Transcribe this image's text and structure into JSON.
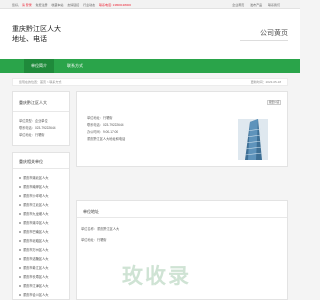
{
  "topbar": {
    "welcome": "您好，",
    "highlight": "请 登录",
    "items": [
      "免费注册",
      "收藏本站",
      "友情链接",
      "行业动态",
      "联系电话: 13800138000"
    ],
    "right_items": [
      "企业黄页",
      "发布产品",
      "联系我们"
    ]
  },
  "site": {
    "title_line1": "重庆黔江区人大",
    "title_line2": "地址、电话",
    "ad_text": "公司黄页"
  },
  "nav": {
    "items": [
      "单位简介",
      "联系方式"
    ]
  },
  "breadcrumb": {
    "text": "您现在的位置：首页 > 联系方式",
    "time": "更新时间：2023-05-18"
  },
  "left_panel": {
    "title": "重庆黔江区人大",
    "report_label": "我要纠错",
    "rows": [
      {
        "k": "单位类型：",
        "v": "企业单位"
      },
      {
        "k": "联系电话：",
        "v": "023-79222644"
      },
      {
        "k": "单位地址：",
        "v": "行署街"
      }
    ]
  },
  "related": {
    "title": "重庆相关单位",
    "items": [
      "重庆市渝北区人大",
      "重庆市南岸区人大",
      "重庆市沙坪坝人大",
      "重庆市江北区人大",
      "重庆市九龙坡人大",
      "重庆市渝中区人大",
      "重庆市巴南区人大",
      "重庆市北碚区人大",
      "重庆市万州区人大",
      "重庆市涪陵区人大",
      "重庆市綦江区人大",
      "重庆市长寿区人大",
      "重庆市江津区人大",
      "重庆市合川区人大"
    ]
  },
  "contact": {
    "rows": [
      {
        "k": "单位地址：",
        "v": "行署街"
      },
      {
        "k": "联系电话：",
        "v": "023-79222644"
      },
      {
        "k": "办公时间：",
        "v": "9:00-17:00"
      },
      {
        "k": "",
        "v": "重庆黔江区人大地址和电话"
      }
    ]
  },
  "address_panel": {
    "title": "单位地址",
    "rows": [
      {
        "k": "单位名称：",
        "v": "重庆黔江区人大"
      },
      {
        "k": "单位地址：",
        "v": "行署街"
      }
    ]
  },
  "watermark": "玫收录",
  "colors": {
    "nav_bg": "#2aa44a",
    "nav_active": "#1f8a3b",
    "watermark": "#cfe3d4"
  }
}
